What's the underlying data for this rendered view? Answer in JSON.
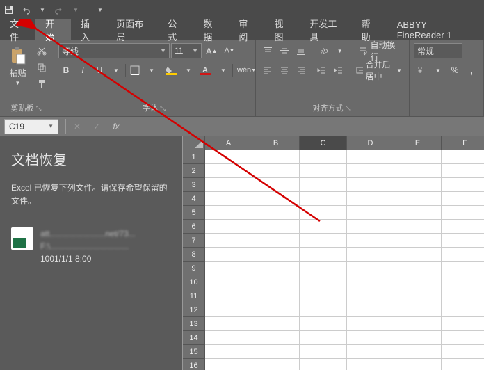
{
  "titlebar": {
    "save_icon": "save",
    "undo_icon": "undo",
    "redo_icon": "redo"
  },
  "menu": {
    "tabs": [
      {
        "label": "文件"
      },
      {
        "label": "开始"
      },
      {
        "label": "插入"
      },
      {
        "label": "页面布局"
      },
      {
        "label": "公式"
      },
      {
        "label": "数据"
      },
      {
        "label": "审阅"
      },
      {
        "label": "视图"
      },
      {
        "label": "开发工具"
      },
      {
        "label": "帮助"
      },
      {
        "label": "ABBYY FineReader 1"
      }
    ],
    "active_index": 1
  },
  "ribbon": {
    "clipboard": {
      "paste_label": "粘贴",
      "group_label": "剪贴板"
    },
    "font": {
      "font_name": "等线",
      "font_size": "11",
      "group_label": "字体",
      "bold": "B",
      "italic": "I",
      "underline": "U"
    },
    "alignment": {
      "wrap_label": "自动换行",
      "merge_label": "合并后居中",
      "group_label": "对齐方式"
    },
    "number": {
      "format": "常规"
    }
  },
  "formula_bar": {
    "cell_ref": "C19",
    "fx_label": "fx"
  },
  "recovery": {
    "title": "文档恢复",
    "message": "Excel 已恢复下列文件。请保存希望保留的文件。",
    "item": {
      "line1": "att........................net/73...",
      "line2": "F:\\..................................",
      "timestamp": "1001/1/1 8:00"
    }
  },
  "sheet": {
    "columns": [
      "A",
      "B",
      "C",
      "D",
      "E",
      "F"
    ],
    "row_count": 16,
    "selected_column_index": 2
  }
}
